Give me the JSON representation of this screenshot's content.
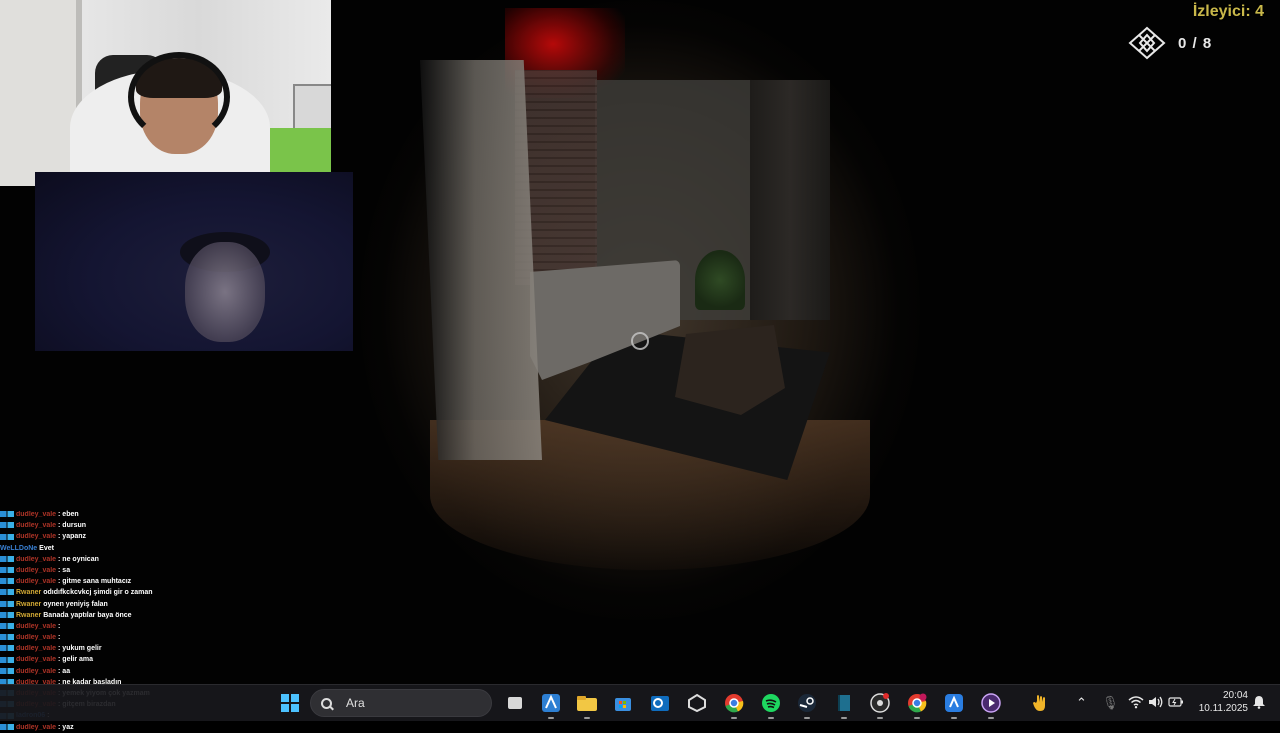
{
  "hud": {
    "viewer_prefix": "İzle",
    "viewer_label": "İzleyici: 4",
    "collect_count": "0 / 8"
  },
  "chat": [
    {
      "user": "dudley_vale",
      "msg": ": eben",
      "badge": true,
      "color": "red"
    },
    {
      "user": "dudley_vale",
      "msg": ": dursun",
      "badge": true,
      "color": "red"
    },
    {
      "user": "dudley_vale",
      "msg": ": yapanz",
      "badge": true,
      "color": "red"
    },
    {
      "user": "WeLLDoNe",
      "msg": "Evet",
      "badge": false,
      "color": "alt"
    },
    {
      "user": "dudley_vale",
      "msg": ": ne oynican",
      "badge": true,
      "color": "red"
    },
    {
      "user": "dudley_vale",
      "msg": ": sa",
      "badge": true,
      "color": "red"
    },
    {
      "user": "dudley_vale",
      "msg": ": gitme sana muhtacız",
      "badge": true,
      "color": "red"
    },
    {
      "user": "Rwaner",
      "msg": "odıdıfkckcvkcj şimdi gir o zaman",
      "badge": true,
      "color": "gold"
    },
    {
      "user": "Rwaner",
      "msg": "oynen yeniyiş falan",
      "badge": true,
      "color": "gold"
    },
    {
      "user": "Rwaner",
      "msg": "Banada yaptılar baya önce",
      "badge": true,
      "color": "gold"
    },
    {
      "user": "dudley_vale",
      "msg": ":",
      "badge": true,
      "color": "red"
    },
    {
      "user": "dudley_vale",
      "msg": ":",
      "badge": true,
      "color": "red"
    },
    {
      "user": "dudley_vale",
      "msg": ": yukum gelir",
      "badge": true,
      "color": "red"
    },
    {
      "user": "dudley_vale",
      "msg": ": gelir ama",
      "badge": true,
      "color": "red"
    },
    {
      "user": "dudley_vale",
      "msg": ": aa",
      "badge": true,
      "color": "red"
    },
    {
      "user": "dudley_vale",
      "msg": ": ne kadar başladın",
      "badge": true,
      "color": "red"
    },
    {
      "user": "dudley_vale",
      "msg": ": yemek yiyom çok yazmam",
      "badge": true,
      "color": "red"
    },
    {
      "user": "dudley_vale",
      "msg": ": gitçem birazdan",
      "badge": true,
      "color": "red"
    },
    {
      "user": "ladron06",
      "msg": ":",
      "badge": true,
      "color": "alt"
    },
    {
      "user": "dudley_vale",
      "msg": ": yaz",
      "badge": true,
      "color": "red"
    }
  ],
  "taskbar": {
    "search_placeholder": "Ara",
    "time": "20:04",
    "date": "10.11.2025",
    "apps": [
      "windows-start-icon",
      "task-view-icon",
      "azure-icon",
      "file-explorer-icon",
      "microsoft-store-icon",
      "outlook-icon",
      "unity-icon",
      "chrome-icon",
      "spotify-icon",
      "steam-icon",
      "book-icon",
      "obs-icon",
      "chrome-profile-icon",
      "app-icon",
      "media-player-icon"
    ]
  },
  "colors": {
    "accent_gold": "#c9b84a",
    "accent_purple": "#8c3fe0",
    "taskbar": "#18181c"
  }
}
